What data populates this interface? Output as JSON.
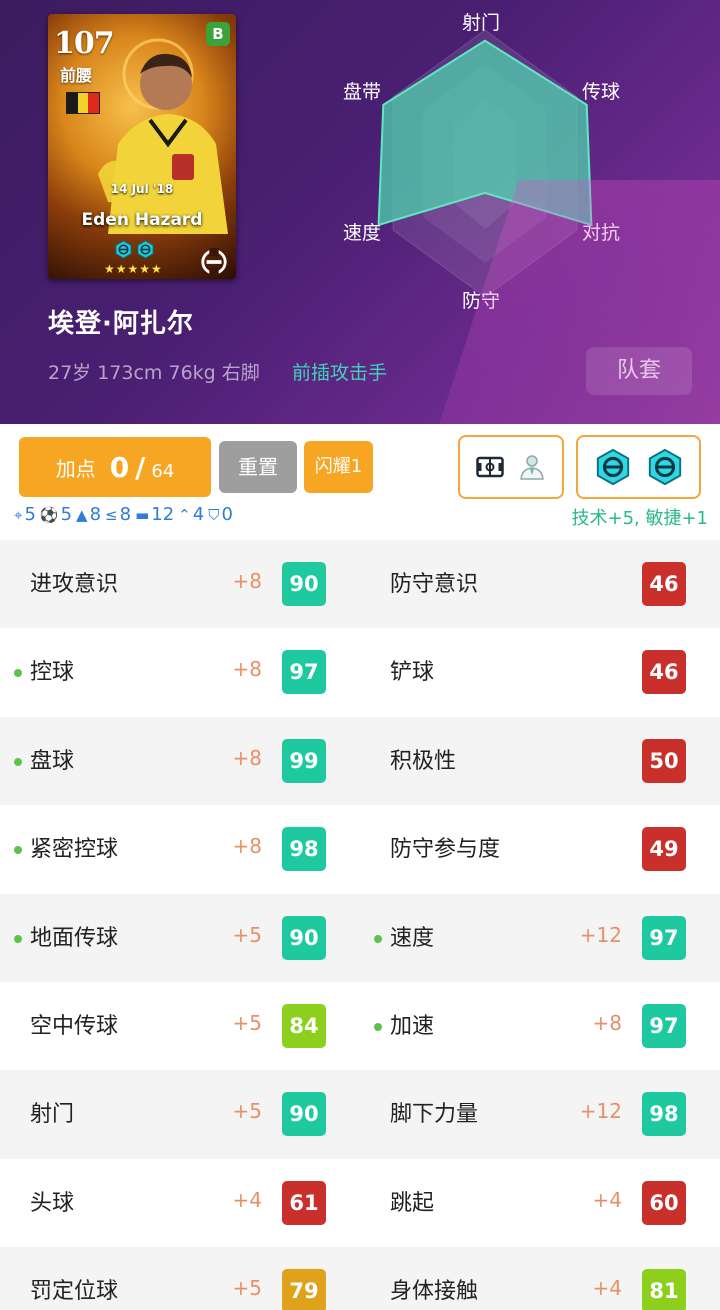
{
  "card": {
    "rating": "107",
    "position": "前腰",
    "badge": "B",
    "flag_colors": [
      "#1a1a1a",
      "#f3d02a",
      "#e0281e"
    ],
    "date": "14 Jul '18",
    "name": "Eden Hazard",
    "stars": "★★★★★"
  },
  "player": {
    "name": "埃登·阿扎尔",
    "info": "27岁 173cm 76kg 右脚",
    "style": "前插攻击手",
    "kit_label": "队套"
  },
  "radar": {
    "labels": [
      "射门",
      "传球",
      "对抗",
      "防守",
      "速度",
      "盘带"
    ],
    "values": [
      0.92,
      0.88,
      0.92,
      0.22,
      0.92,
      0.88
    ],
    "fill_color": "#4fd2ad"
  },
  "toolbar": {
    "points_label": "加点",
    "points_current": "0",
    "points_slash": "/",
    "points_max": "64",
    "reset_label": "重置",
    "shine_label": "闪耀1",
    "boosts": [
      {
        "icon": "crosshair-icon",
        "value": "5"
      },
      {
        "icon": "ball-icon",
        "value": "5"
      },
      {
        "icon": "triangle-icon",
        "value": "8"
      },
      {
        "icon": "less-equal-icon",
        "value": "8"
      },
      {
        "icon": "boot-icon",
        "value": "12"
      },
      {
        "icon": "chevron-up-icon",
        "value": "4"
      },
      {
        "icon": "shield-icon",
        "value": "0"
      }
    ],
    "bonus_text": "技术+5, 敏捷+1"
  },
  "stats": [
    {
      "left": {
        "name": "进攻意识",
        "dot": false,
        "inc": "+8",
        "value": "90",
        "color": "#1fc9a0"
      },
      "right": {
        "name": "防守意识",
        "dot": false,
        "inc": "",
        "value": "46",
        "color": "#c9302c"
      }
    },
    {
      "left": {
        "name": "控球",
        "dot": true,
        "inc": "+8",
        "value": "97",
        "color": "#1fc9a0"
      },
      "right": {
        "name": "铲球",
        "dot": false,
        "inc": "",
        "value": "46",
        "color": "#c9302c"
      }
    },
    {
      "left": {
        "name": "盘球",
        "dot": true,
        "inc": "+8",
        "value": "99",
        "color": "#1fc9a0"
      },
      "right": {
        "name": "积极性",
        "dot": false,
        "inc": "",
        "value": "50",
        "color": "#c9302c"
      }
    },
    {
      "left": {
        "name": "紧密控球",
        "dot": true,
        "inc": "+8",
        "value": "98",
        "color": "#1fc9a0"
      },
      "right": {
        "name": "防守参与度",
        "dot": false,
        "inc": "",
        "value": "49",
        "color": "#c9302c"
      }
    },
    {
      "left": {
        "name": "地面传球",
        "dot": true,
        "inc": "+5",
        "value": "90",
        "color": "#1fc9a0"
      },
      "right": {
        "name": "速度",
        "dot": true,
        "inc": "+12",
        "value": "97",
        "color": "#1fc9a0"
      }
    },
    {
      "left": {
        "name": "空中传球",
        "dot": false,
        "inc": "+5",
        "value": "84",
        "color": "#8ccf1c"
      },
      "right": {
        "name": "加速",
        "dot": true,
        "inc": "+8",
        "value": "97",
        "color": "#1fc9a0"
      }
    },
    {
      "left": {
        "name": "射门",
        "dot": false,
        "inc": "+5",
        "value": "90",
        "color": "#1fc9a0"
      },
      "right": {
        "name": "脚下力量",
        "dot": false,
        "inc": "+12",
        "value": "98",
        "color": "#1fc9a0"
      }
    },
    {
      "left": {
        "name": "头球",
        "dot": false,
        "inc": "+4",
        "value": "61",
        "color": "#c9302c"
      },
      "right": {
        "name": "跳起",
        "dot": false,
        "inc": "+4",
        "value": "60",
        "color": "#c9302c"
      }
    },
    {
      "left": {
        "name": "罚定位球",
        "dot": false,
        "inc": "+5",
        "value": "79",
        "color": "#e0a21a"
      },
      "right": {
        "name": "身体接触",
        "dot": false,
        "inc": "+4",
        "value": "81",
        "color": "#8ccf1c"
      }
    }
  ]
}
